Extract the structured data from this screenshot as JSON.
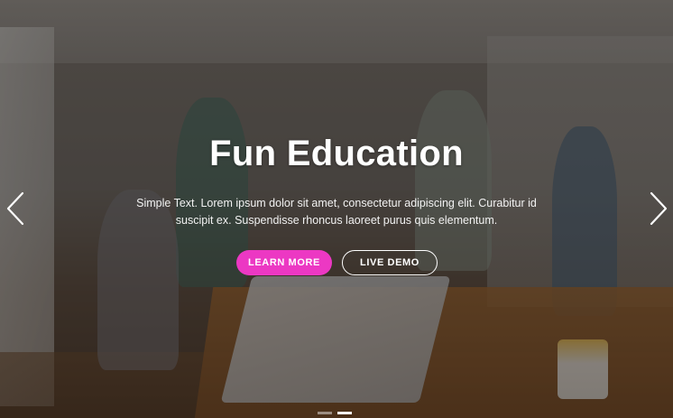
{
  "hero": {
    "title": "Fun Education",
    "subtitle": "Simple Text. Lorem ipsum dolor sit amet, consectetur adipiscing elit. Curabitur id suscipit ex. Suspendisse rhoncus laoreet purus quis elementum.",
    "primary_button": "LEARN MORE",
    "secondary_button": "LIVE DEMO",
    "accent_color": "#ec38c3"
  },
  "carousel": {
    "prev_icon": "chevron-left-icon",
    "next_icon": "chevron-right-icon",
    "slide_count": 2,
    "active_index": 1
  }
}
